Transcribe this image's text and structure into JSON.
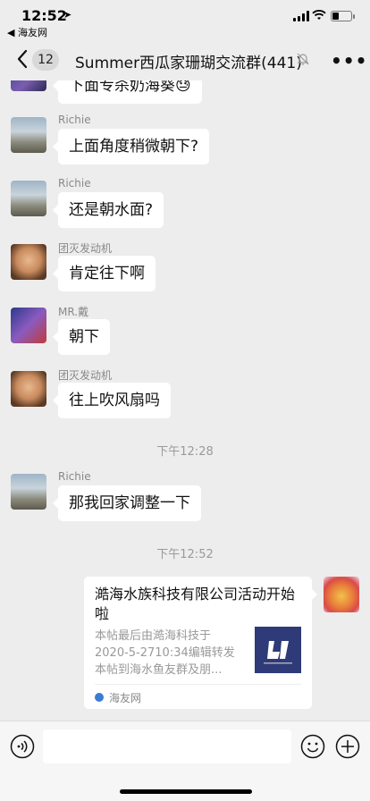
{
  "status_bar": {
    "time": "12:52",
    "back_app": "◀ 海友网"
  },
  "nav": {
    "unread_count": "12",
    "title": "Summer西瓜家珊瑚交流群(441)"
  },
  "messages": [
    {
      "sender": "",
      "text": "下面专杀奶海葵😓"
    },
    {
      "sender": "Richie",
      "text": "上面角度稍微朝下?"
    },
    {
      "sender": "Richie",
      "text": "还是朝水面?"
    },
    {
      "sender": "团灭发动机",
      "text": "肯定往下啊"
    },
    {
      "sender": "MR.戴",
      "text": "朝下"
    },
    {
      "sender": "团灭发动机",
      "text": "往上吹风扇吗"
    },
    {
      "sender": "Richie",
      "text": "那我回家调整一下"
    }
  ],
  "timestamps": [
    "下午12:28",
    "下午12:52"
  ],
  "link_card": {
    "title": "澔海水族科技有限公司活动开始啦",
    "desc_lines": [
      "本帖最后由澔海科技于",
      "2020-5-2710:34编辑转发",
      "本帖到海水鱼友群及朋..."
    ],
    "source": "海友网"
  },
  "colors": {
    "background": "#ededed",
    "bubble": "#ffffff",
    "thumbnail": "#2e3b78"
  }
}
